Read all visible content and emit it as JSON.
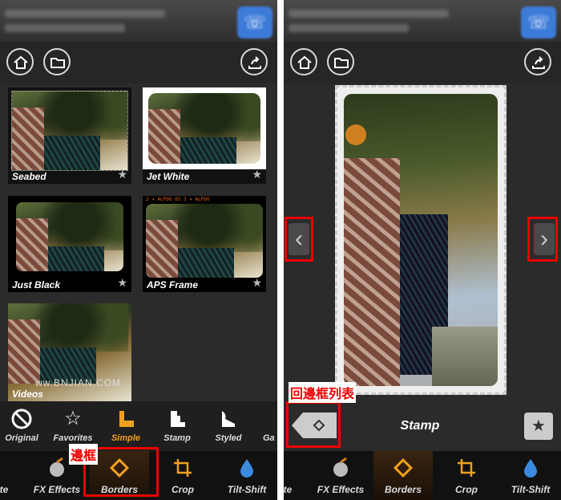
{
  "left_panel": {
    "tiles": [
      {
        "label": "Seabed"
      },
      {
        "label": "Jet White"
      },
      {
        "label": "Just Black"
      },
      {
        "label": "APS Frame"
      },
      {
        "label": "Videos"
      }
    ],
    "categories": [
      {
        "label": "Original",
        "icon": "no-icon"
      },
      {
        "label": "Favorites",
        "icon": "star-outline-icon"
      },
      {
        "label": "Simple",
        "icon": "simple-frame-icon",
        "active": true
      },
      {
        "label": "Stamp",
        "icon": "stamp-icon"
      },
      {
        "label": "Styled",
        "icon": "styled-icon"
      },
      {
        "label": "Ga",
        "icon": "gallery-icon"
      }
    ],
    "tools": [
      {
        "label": "te"
      },
      {
        "label": "FX Effects",
        "icon": "fx-effects-icon"
      },
      {
        "label": "Borders",
        "icon": "borders-icon",
        "active": true
      },
      {
        "label": "Crop",
        "icon": "crop-icon"
      },
      {
        "label": "Tilt-Shift",
        "icon": "tilt-shift-icon"
      }
    ],
    "annotation": "邊框",
    "watermark": "ww.BNJIAN.COM"
  },
  "right_panel": {
    "title": "Stamp",
    "annotation": "回邊框列表",
    "tools": [
      {
        "label": "te"
      },
      {
        "label": "FX Effects"
      },
      {
        "label": "Borders",
        "active": true
      },
      {
        "label": "Crop"
      },
      {
        "label": "Tilt-Shift"
      }
    ]
  },
  "colors": {
    "accent_orange": "#f0a020",
    "annotation_red": "#e00000",
    "background": "#2b2b2b"
  }
}
